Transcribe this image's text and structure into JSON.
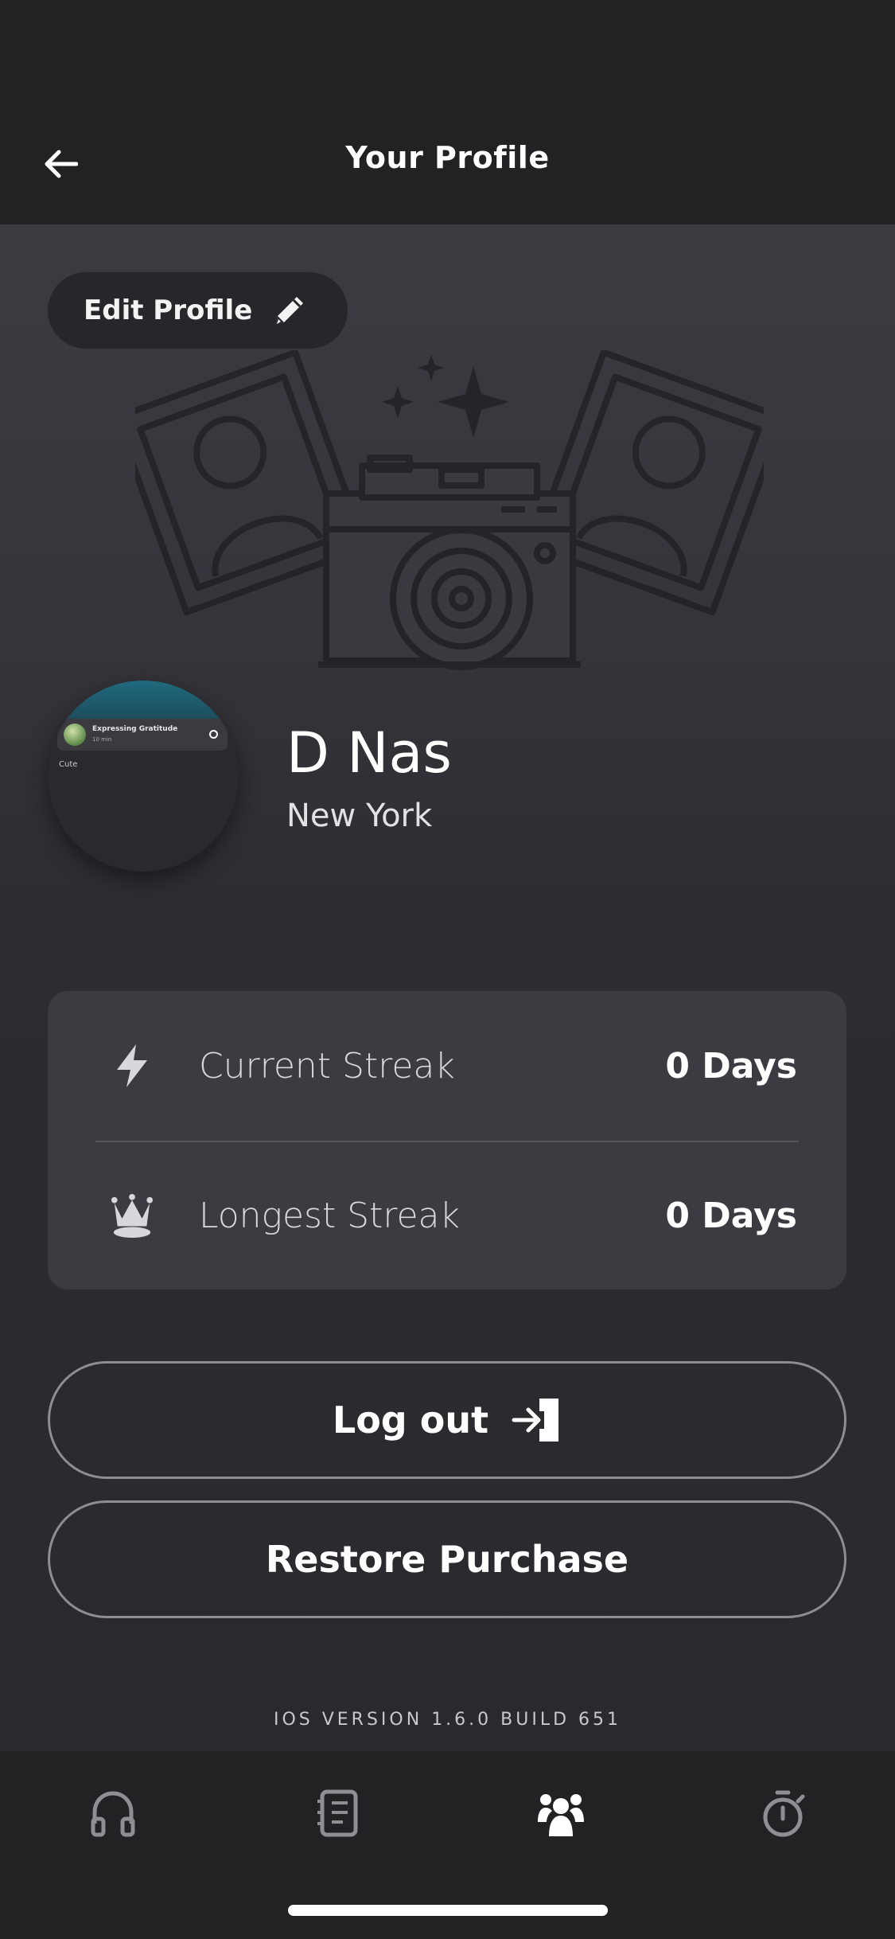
{
  "header": {
    "title": "Your Profile",
    "back_icon": "arrow-left-icon"
  },
  "profile": {
    "edit_label": "Edit Profile",
    "edit_icon": "pencil-icon",
    "name": "D Nas",
    "location": "New York",
    "avatar": {
      "card_title": "Expressing Gratitude",
      "card_duration": "10 min",
      "caption": "Cute"
    }
  },
  "streaks": [
    {
      "icon": "lightning-icon",
      "label": "Current Streak",
      "value": "0 Days"
    },
    {
      "icon": "crown-icon",
      "label": "Longest Streak",
      "value": "0 Days"
    }
  ],
  "actions": {
    "logout_label": "Log out",
    "logout_icon": "exit-door-icon",
    "restore_label": "Restore Purchase"
  },
  "footer": {
    "version": "IOS VERSION 1.6.0 BUILD 651"
  },
  "tabbar": {
    "items": [
      {
        "icon": "headphones-icon",
        "active": false
      },
      {
        "icon": "journal-icon",
        "active": false
      },
      {
        "icon": "community-icon",
        "active": true
      },
      {
        "icon": "timer-icon",
        "active": false
      }
    ]
  },
  "colors": {
    "background": "#2b2b30",
    "bar": "#222225",
    "card": "#3b3b41",
    "text": "#ffffff",
    "muted": "#d8d8dc"
  }
}
